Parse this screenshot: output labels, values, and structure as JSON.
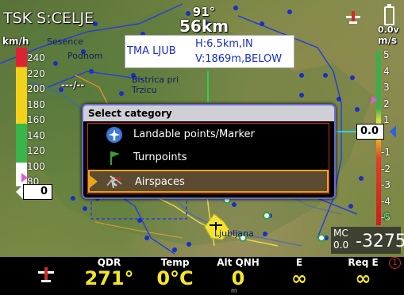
{
  "app": {
    "title": "TSK S:CELJE",
    "distance_top": "91°",
    "distance_value": "56km"
  },
  "airspace_popup": {
    "name": "TMA LJUB",
    "height": "H:6.5km,IN",
    "vertical": "V:1869m,BELOW"
  },
  "map_labels": {
    "place1": "Sesence",
    "place2": "Podhom",
    "place3": "Bistrica pri\nTrzicu",
    "place4": "Ljubljana",
    "dashes": "---/--"
  },
  "speed": {
    "unit": "km/h",
    "ticks": [
      "240",
      "220",
      "200",
      "180",
      "160",
      "140",
      "120",
      "100",
      "80"
    ],
    "current": "0"
  },
  "vario": {
    "voltage": "0.0v",
    "unit": "m/s",
    "ticks": [
      "5",
      "4",
      "3",
      "2",
      "1",
      "0.0",
      "-1",
      "-2",
      "-3",
      "-4",
      "-5",
      "0"
    ],
    "current": "0.0"
  },
  "mc": {
    "label": "MC",
    "value": "0.0",
    "altitude": "-3275"
  },
  "dialog": {
    "title": "Select category",
    "items": [
      {
        "label": "Landable points/Marker",
        "icon": "airplane-icon"
      },
      {
        "label": "Turnpoints",
        "icon": "flag-icon"
      },
      {
        "label": "Airspaces",
        "icon": "airspace-icon",
        "selected": true
      }
    ]
  },
  "bottom_bar": {
    "fields": [
      {
        "title": "QDR",
        "value": "271°"
      },
      {
        "title": "Temp",
        "value": "0°C"
      },
      {
        "title": "Alt QNH",
        "value": "0"
      },
      {
        "title": "E",
        "value": "∞"
      },
      {
        "title": "Req E",
        "value": "∞"
      }
    ],
    "alt_unit": "m",
    "alert_count": "1"
  },
  "colors": {
    "accent_yellow": "#f5e626",
    "dialog_border": "#6a6ad6",
    "selection": "#e8a41e",
    "airspace_blue": "#2a3fd6"
  }
}
